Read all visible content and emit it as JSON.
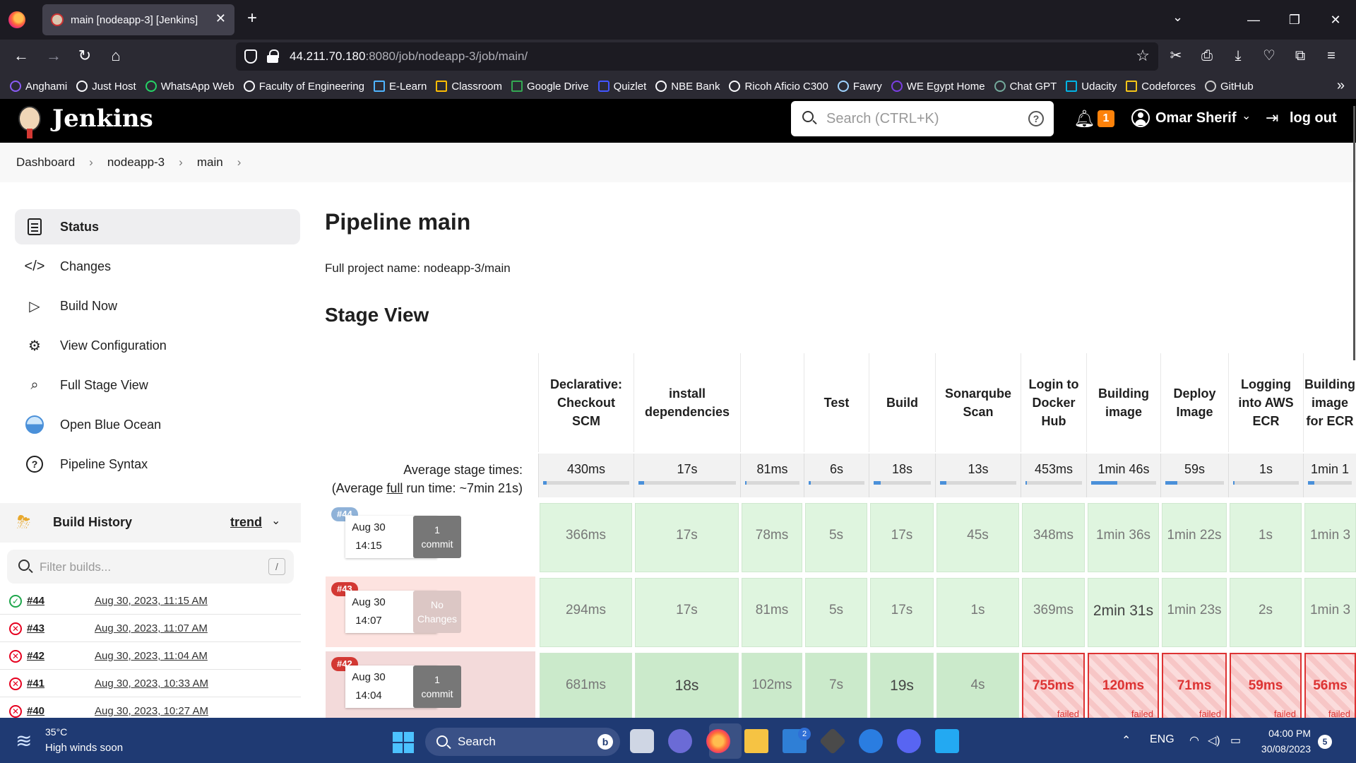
{
  "browser": {
    "tab_title": "main [nodeapp-3] [Jenkins]",
    "url_host": "44.211.70.180",
    "url_rest": ":8080/job/nodeapp-3/job/main/",
    "bookmarks": [
      "Anghami",
      "Just Host",
      "WhatsApp Web",
      "Faculty of Engineering",
      "E-Learn",
      "Classroom",
      "Google Drive",
      "Quizlet",
      "NBE Bank",
      "Ricoh Aficio C300",
      "Fawry",
      "WE Egypt Home",
      "Chat GPT",
      "Udacity",
      "Codeforces",
      "GitHub"
    ]
  },
  "header": {
    "title": "Jenkins",
    "search_placeholder": "Search (CTRL+K)",
    "notification_count": "1",
    "user_name": "Omar Sherif",
    "logout_label": "log out"
  },
  "breadcrumb": [
    "Dashboard",
    "nodeapp-3",
    "main"
  ],
  "sidebar": {
    "tasks": [
      "Status",
      "Changes",
      "Build Now",
      "View Configuration",
      "Full Stage View",
      "Open Blue Ocean",
      "Pipeline Syntax"
    ]
  },
  "build_history": {
    "title": "Build History",
    "trend_label": "trend",
    "filter_placeholder": "Filter builds...",
    "filter_shortcut": "/",
    "builds": [
      {
        "num": "#44",
        "date": "Aug 30, 2023, 11:15 AM",
        "status": "success"
      },
      {
        "num": "#43",
        "date": "Aug 30, 2023, 11:07 AM",
        "status": "failed"
      },
      {
        "num": "#42",
        "date": "Aug 30, 2023, 11:04 AM",
        "status": "failed"
      },
      {
        "num": "#41",
        "date": "Aug 30, 2023, 10:33 AM",
        "status": "failed"
      },
      {
        "num": "#40",
        "date": "Aug 30, 2023, 10:27 AM",
        "status": "failed"
      }
    ]
  },
  "main": {
    "title": "Pipeline main",
    "full_name": "Full project name: nodeapp-3/main",
    "stage_view_title": "Stage View",
    "avg_label_1": "Average stage times:",
    "avg_label_2_pre": "(Average ",
    "avg_label_2_link": "full",
    "avg_label_2_post": " run time: ~7min 21s)"
  },
  "stages": [
    {
      "name": "Declarative: Checkout SCM",
      "avg": "430ms",
      "avg_fill": 0.04
    },
    {
      "name": "install dependencies",
      "avg": "17s",
      "avg_fill": 0.06
    },
    {
      "name": "",
      "avg": "81ms",
      "avg_fill": 0.03
    },
    {
      "name": "Test",
      "avg": "6s",
      "avg_fill": 0.04
    },
    {
      "name": "Build",
      "avg": "18s",
      "avg_fill": 0.12
    },
    {
      "name": "Sonarqube Scan",
      "avg": "13s",
      "avg_fill": 0.08
    },
    {
      "name": "Login to Docker Hub",
      "avg": "453ms",
      "avg_fill": 0.03
    },
    {
      "name": "Building image",
      "avg": "1min 46s",
      "avg_fill": 0.4
    },
    {
      "name": "Deploy Image",
      "avg": "59s",
      "avg_fill": 0.2
    },
    {
      "name": "Logging into AWS ECR",
      "avg": "1s",
      "avg_fill": 0.02
    },
    {
      "name": "Building image for ECR",
      "avg": "1min 1",
      "avg_fill": 0.15
    }
  ],
  "runs": [
    {
      "badge": "#44",
      "date": "Aug 30",
      "time": "14:15",
      "changes": [
        "1",
        "commit"
      ],
      "status": "success",
      "cells": [
        {
          "t": "366ms",
          "s": "ok"
        },
        {
          "t": "17s",
          "s": "ok"
        },
        {
          "t": "78ms",
          "s": "ok"
        },
        {
          "t": "5s",
          "s": "ok"
        },
        {
          "t": "17s",
          "s": "ok"
        },
        {
          "t": "45s",
          "s": "ok"
        },
        {
          "t": "348ms",
          "s": "ok"
        },
        {
          "t": "1min 36s",
          "s": "ok"
        },
        {
          "t": "1min 22s",
          "s": "ok"
        },
        {
          "t": "1s",
          "s": "ok"
        },
        {
          "t": "1min 3",
          "s": "ok"
        }
      ]
    },
    {
      "badge": "#43",
      "date": "Aug 30",
      "time": "14:07",
      "changes": [
        "No",
        "Changes"
      ],
      "status": "failed",
      "cells": [
        {
          "t": "294ms",
          "s": "ok"
        },
        {
          "t": "17s",
          "s": "ok"
        },
        {
          "t": "81ms",
          "s": "ok"
        },
        {
          "t": "5s",
          "s": "ok"
        },
        {
          "t": "17s",
          "s": "ok"
        },
        {
          "t": "1s",
          "s": "ok"
        },
        {
          "t": "369ms",
          "s": "ok"
        },
        {
          "t": "2min 31s",
          "s": "okbold"
        },
        {
          "t": "1min 23s",
          "s": "ok"
        },
        {
          "t": "2s",
          "s": "ok"
        },
        {
          "t": "1min 3",
          "s": "ok"
        }
      ]
    },
    {
      "badge": "#42",
      "date": "Aug 30",
      "time": "14:04",
      "changes": [
        "1",
        "commit"
      ],
      "status": "failed",
      "cells": [
        {
          "t": "681ms",
          "s": "okdark"
        },
        {
          "t": "18s",
          "s": "okdarkbold"
        },
        {
          "t": "102ms",
          "s": "okdark"
        },
        {
          "t": "7s",
          "s": "okdark"
        },
        {
          "t": "19s",
          "s": "okdarkbold"
        },
        {
          "t": "4s",
          "s": "okdark"
        },
        {
          "t": "755ms",
          "s": "failed"
        },
        {
          "t": "120ms",
          "s": "failed"
        },
        {
          "t": "71ms",
          "s": "failed"
        },
        {
          "t": "59ms",
          "s": "failed"
        },
        {
          "t": "56ms",
          "s": "failed"
        }
      ]
    }
  ],
  "failed_label": "failed",
  "taskbar": {
    "temperature": "35°C",
    "weather": "High winds soon",
    "search_label": "Search",
    "language": "ENG",
    "time": "04:00 PM",
    "date": "30/08/2023",
    "mail_badge": "2",
    "notification_count": "5"
  }
}
